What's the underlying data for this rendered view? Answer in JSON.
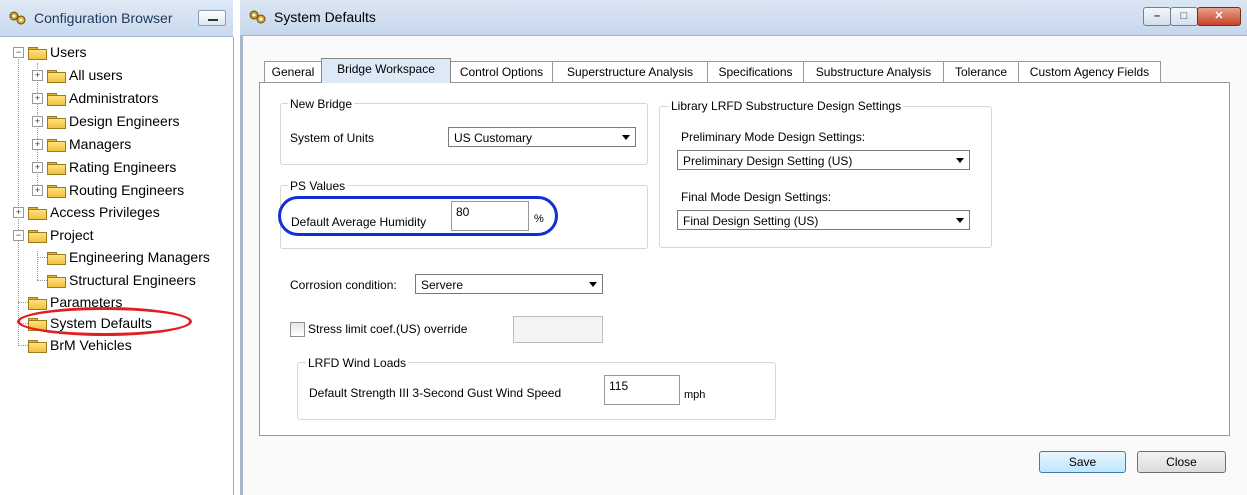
{
  "left_pane": {
    "title": "Configuration Browser",
    "tree": [
      {
        "label": "Users",
        "expander": "−"
      },
      {
        "label": "All users",
        "expander": "+"
      },
      {
        "label": "Administrators",
        "expander": "+"
      },
      {
        "label": "Design Engineers",
        "expander": "+"
      },
      {
        "label": "Managers",
        "expander": "+"
      },
      {
        "label": "Rating Engineers",
        "expander": "+"
      },
      {
        "label": "Routing Engineers",
        "expander": "+"
      },
      {
        "label": "Access Privileges",
        "expander": "+"
      },
      {
        "label": "Project",
        "expander": "−"
      },
      {
        "label": "Engineering Managers"
      },
      {
        "label": "Structural Engineers"
      },
      {
        "label": "Parameters"
      },
      {
        "label": "System Defaults"
      },
      {
        "label": "BrM Vehicles"
      }
    ],
    "highlight_color": "#e02020"
  },
  "window": {
    "title": "System Defaults",
    "caption_buttons": {
      "minimize": "–",
      "maximize": "□",
      "close": "✕"
    },
    "tabs": [
      "General",
      "Bridge Workspace",
      "Control Options",
      "Superstructure Analysis",
      "Specifications",
      "Substructure Analysis",
      "Tolerance",
      "Custom Agency Fields"
    ],
    "active_tab": "Bridge Workspace",
    "new_bridge": {
      "title": "New Bridge",
      "units_label": "System of Units",
      "units_value": "US Customary"
    },
    "ps_values": {
      "title": "PS Values",
      "humidity_label": "Default Average Humidity",
      "humidity_value": "80",
      "humidity_unit": "%",
      "highlight_color": "#1030d0"
    },
    "library": {
      "title": "Library LRFD Substructure Design Settings",
      "preliminary_label": "Preliminary Mode Design Settings:",
      "preliminary_value": "Preliminary Design Setting (US)",
      "final_label": "Final Mode Design Settings:",
      "final_value": "Final Design Setting (US)"
    },
    "corrosion": {
      "label": "Corrosion condition:",
      "value": "Servere"
    },
    "stress": {
      "label": "Stress limit coef.(US) override",
      "checked": false,
      "value": ""
    },
    "wind": {
      "title": "LRFD Wind Loads",
      "label": "Default Strength III 3-Second Gust Wind Speed",
      "value": "115",
      "unit": "mph"
    },
    "buttons": {
      "save": "Save",
      "close": "Close"
    }
  }
}
